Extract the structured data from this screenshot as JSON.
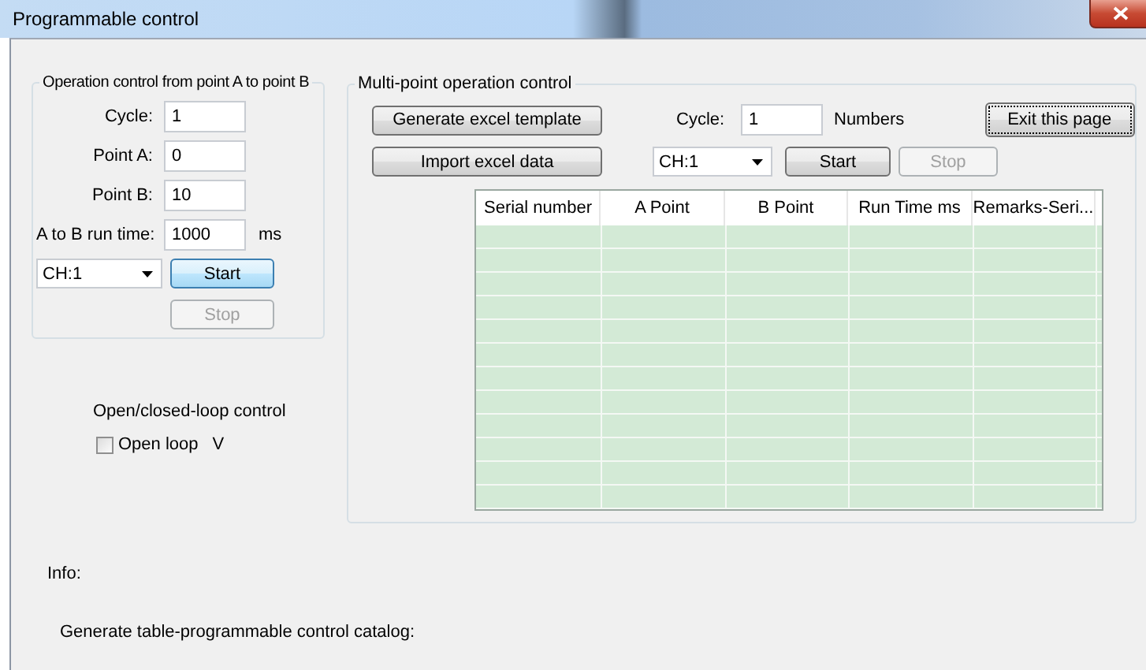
{
  "window": {
    "title": "Programmable control"
  },
  "point_to_point": {
    "title": "Operation control from point A to point B",
    "fields": [
      {
        "label": "Cycle:",
        "value": "1"
      },
      {
        "label": "Point A:",
        "value": "0"
      },
      {
        "label": "Point B:",
        "value": "10"
      },
      {
        "label": "A to B run time:",
        "value": "1000",
        "unit": "ms"
      }
    ],
    "channel": {
      "value": "CH:1"
    },
    "start_button": {
      "label": "Start",
      "disabled": false,
      "highlighted": true
    },
    "stop_button": {
      "label": "Stop",
      "disabled": true
    }
  },
  "loop": {
    "title": "Open/closed-loop control",
    "checkbox": {
      "label": "Open loop",
      "checked": false
    },
    "unit": "V"
  },
  "multi_point": {
    "title": "Multi-point operation control",
    "generate_button": {
      "label": "Generate excel template",
      "disabled": false
    },
    "import_button": {
      "label": "Import excel data",
      "disabled": false
    },
    "cycle": {
      "label": "Cycle:",
      "value": "1",
      "unit": "Numbers"
    },
    "exit_button": {
      "label": "Exit this page",
      "disabled": false,
      "focused": true
    },
    "channel": {
      "value": "CH:1"
    },
    "start_button": {
      "label": "Start",
      "disabled": false
    },
    "stop_button": {
      "label": "Stop",
      "disabled": true
    },
    "table": {
      "columns": [
        "Serial number",
        "A Point",
        "B Point",
        "Run Time ms",
        "Remarks-Seri..."
      ]
    }
  },
  "info": {
    "label": "Info:"
  },
  "catalog": {
    "label": "Generate table-programmable control catalog:"
  }
}
